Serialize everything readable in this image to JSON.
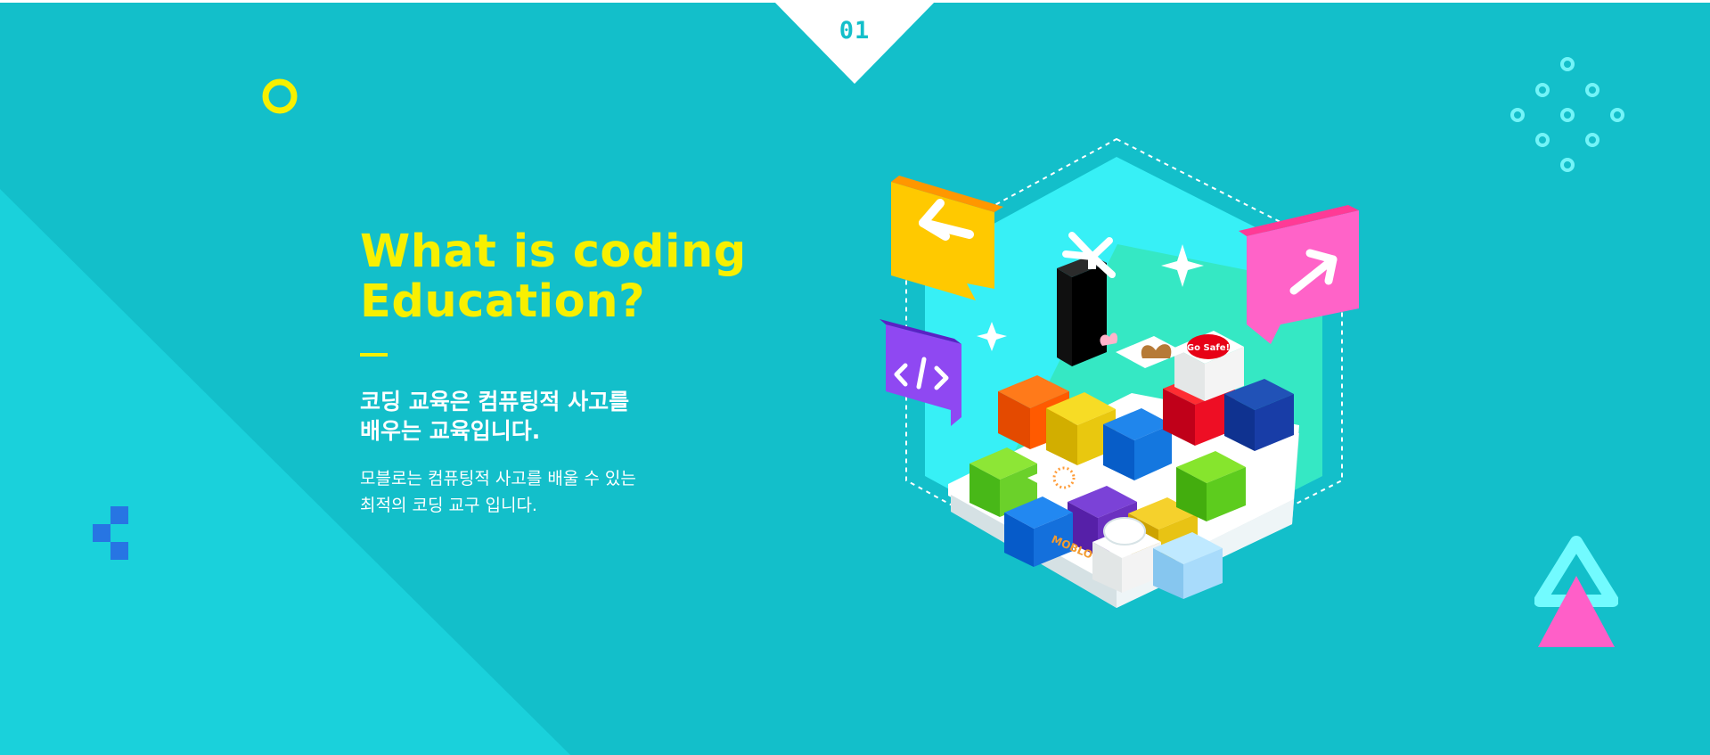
{
  "section": {
    "number": "01"
  },
  "intro": {
    "headline_line1": "What is coding",
    "headline_line2": "Education?",
    "subtitle_line1": "코딩 교육은 컴퓨팅적 사고를",
    "subtitle_line2": "배우는 교육입니다.",
    "body_line1": "모블로는 컴퓨팅적 사고를 배울 수 있는",
    "body_line2": "최적의 코딩 교구 입니다."
  },
  "product": {
    "brand_label": "MOBLO",
    "sticker_text": "Go Safe!",
    "arrow_left_icon": "arrow-left-icon",
    "arrow_right_icon": "arrow-right-icon",
    "code_icon": "code-brackets-icon"
  },
  "colors": {
    "background": "#13bfca",
    "background_light": "#1ad1db",
    "headline": "#f8f000",
    "text": "#ffffff",
    "ring": "#f8f000",
    "dots": "#73f4f8",
    "blocks": "#2775e3",
    "triangle_outline": "#72fbff",
    "triangle_fill": "#ff5fc8",
    "bubble_yellow": "#ffd200",
    "bubble_pink": "#ff5fc8",
    "bubble_purple": "#8f48f2"
  }
}
